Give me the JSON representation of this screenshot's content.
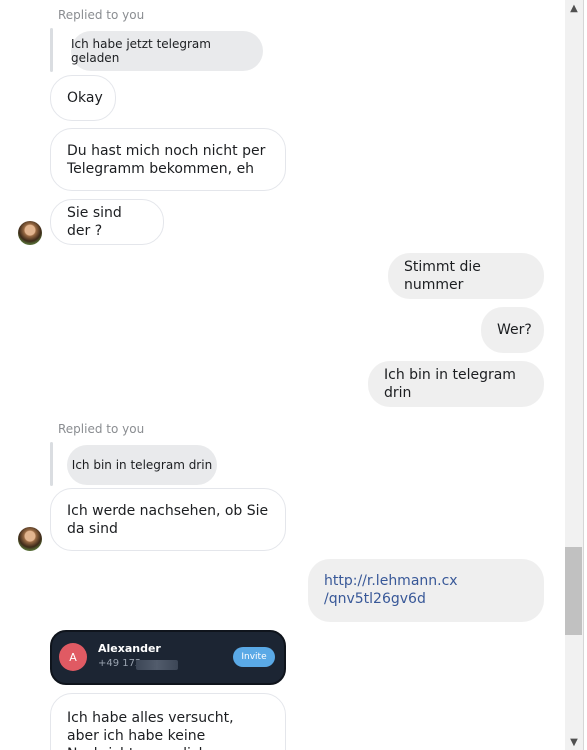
{
  "messages": {
    "reply1": {
      "caption": "Replied to you",
      "quoted": "Ich habe jetzt telegram geladen"
    },
    "okay": "Okay",
    "noch_nicht": "Du hast mich noch nicht per Telegramm bekommen, eh",
    "sie_sind": "Sie sind der ?",
    "stimmt": "Stimmt die nummer",
    "wer": "Wer?",
    "bin_drin": "Ich bin in telegram drin",
    "reply2": {
      "caption": "Replied to you",
      "quoted": "Ich bin in telegram drin"
    },
    "nachsehen": "Ich werde nachsehen, ob Sie da sind",
    "link_line1": "http://r.lehmann.cx",
    "link_line2": "/qnv5tl26gv6d",
    "contact": {
      "avatar_letter": "A",
      "name": "Alexander",
      "phone_prefix": "+49 172",
      "invite_label": "Invite"
    },
    "versucht": "Ich habe alles versucht, aber ich habe keine Nachrichten an dich"
  },
  "icons": {
    "avatar": "contact-avatar",
    "scroll_down": "chevron-down-icon",
    "scroll_up": "chevron-up-icon"
  },
  "colors": {
    "outgoing_bubble": "#efefef",
    "incoming_border": "#e4e6eb",
    "contact_card": "#1c2533",
    "invite": "#5aa9e6",
    "link": "#385898"
  }
}
